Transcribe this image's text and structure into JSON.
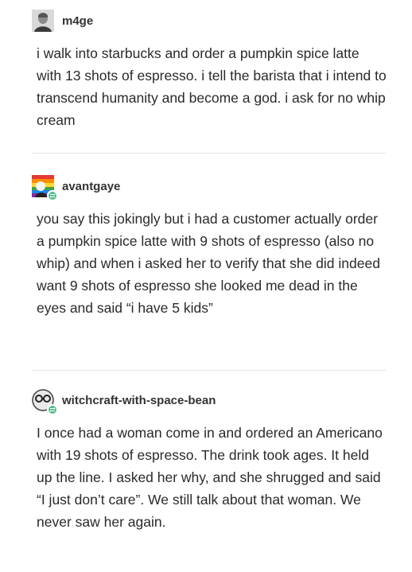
{
  "posts": [
    {
      "username": "m4ge",
      "avatar_icon": "user-portrait-icon",
      "body": "i walk into starbucks and order a pumpkin spice latte with 13 shots of espresso. i tell the barista that i intend to transcend humanity and become a god. i ask for no whip cream"
    },
    {
      "username": "avantgaye",
      "avatar_icon": "rainbow-avatar-icon",
      "reblog_icon": "reblog-icon",
      "body": "you say this jokingly but i had a customer actually order a pumpkin spice latte with 9 shots of espresso (also no whip) and when i asked her to verify that she did indeed want 9 shots of espresso she looked me dead in the eyes and said “i have 5 kids”"
    },
    {
      "username": "witchcraft-with-space-bean",
      "avatar_icon": "glasses-avatar-icon",
      "reblog_icon": "reblog-icon",
      "body": "I once had a woman come in and ordered an Americano with 19 shots of espresso. The drink took ages. It held up the line. I asked her why, and she shrugged and said “I just don’t care”. We still talk about that woman. We never saw her again."
    }
  ],
  "colors": {
    "text": "#2a2a2a",
    "username": "#333333",
    "divider": "#e6e6e6",
    "reblog_badge": "#56bc8a"
  }
}
